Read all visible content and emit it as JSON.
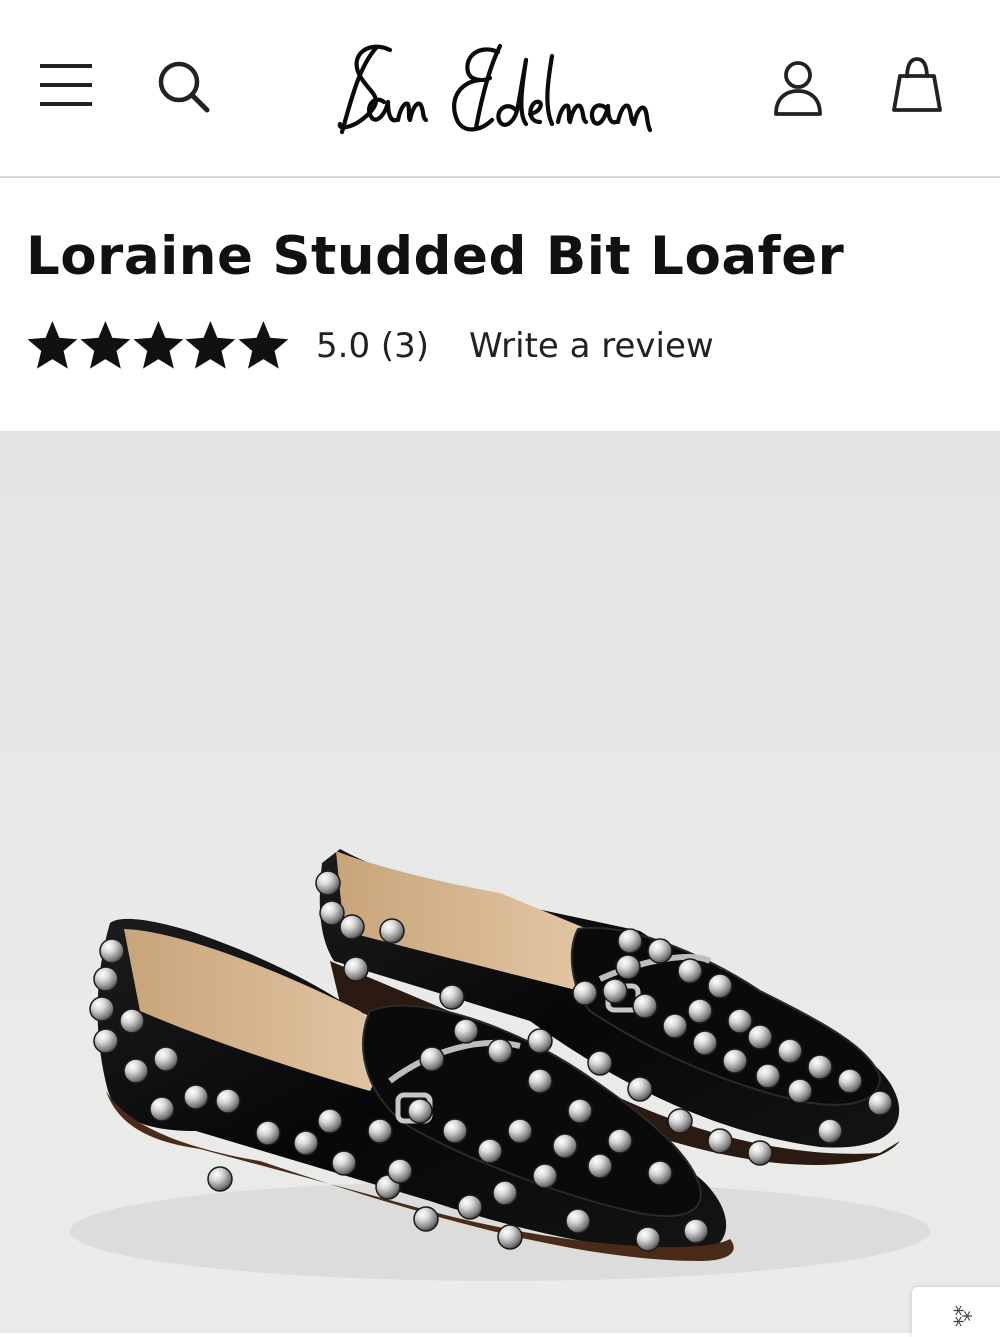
{
  "header": {
    "brand": "Sam Edelman",
    "icons": [
      "menu-icon",
      "search-icon",
      "account-icon",
      "shopping-bag-icon"
    ]
  },
  "product": {
    "title": "Loraine Studded Bit Loafer",
    "rating": {
      "stars": 5,
      "max_stars": 5,
      "value_text": "5.0 (3)",
      "write_review": "Write a review"
    }
  },
  "corner_tab": {
    "glyph": "⁂"
  },
  "colors": {
    "text": "#111111",
    "divider": "#d9d9d9",
    "image_background": "#e8e8e7",
    "shoe_leather": "#0b0b0b",
    "shoe_lining": "#d9b993",
    "stud_silver": "#c9c9c9"
  }
}
